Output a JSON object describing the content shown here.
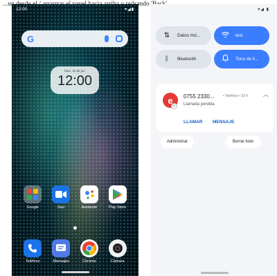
{
  "caption": "...un desde el / arrastrar el panel hacia arriba o pulsando 'Back'.",
  "home": {
    "status_time": "12:00",
    "status_icons": "▾◢▮",
    "google_g": "G",
    "clock_date": "Mon, 19 de jun",
    "clock_time": "12:00",
    "apps_row1": [
      {
        "label": "Google",
        "icon": "google-folder-icon"
      },
      {
        "label": "Duo",
        "icon": "duo-icon"
      },
      {
        "label": "Asistente",
        "icon": "assistant-icon"
      },
      {
        "label": "Play Store",
        "icon": "play-store-icon"
      }
    ],
    "apps_row2": [
      {
        "label": "Teléfono",
        "icon": "phone-icon"
      },
      {
        "label": "Mensajes",
        "icon": "messages-icon"
      },
      {
        "label": "Chrome",
        "icon": "chrome-icon"
      },
      {
        "label": "Cámara",
        "icon": "camera-icon"
      }
    ]
  },
  "shade": {
    "status_icons": "▾◢ ▮",
    "tiles": [
      {
        "label": "Datos mó...",
        "icon": "mobile-data-icon",
        "active": false
      },
      {
        "label": "test",
        "icon": "wifi-icon",
        "active": true
      },
      {
        "label": "Bluetooth",
        "icon": "bluetooth-icon",
        "active": false
      },
      {
        "label": "Tono de ll...",
        "icon": "bell-icon",
        "active": true
      }
    ],
    "notification": {
      "title": "0755 2330...",
      "meta": "• Teléfono • 23 h",
      "body": "Llamada perdida",
      "avatar_letter": "e",
      "actions": [
        "LLAMAR",
        "MENSAJE"
      ]
    },
    "manage_label": "Administrar",
    "clear_label": "Borrar todo"
  },
  "colors": {
    "accent_blue": "#3a7dff",
    "link_blue": "#1a5fd0",
    "missed_red": "#e53935"
  }
}
